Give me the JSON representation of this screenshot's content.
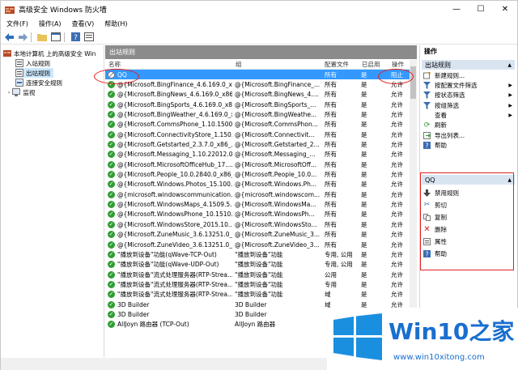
{
  "window": {
    "title": "高级安全 Windows 防火墙"
  },
  "menu": [
    "文件(F)",
    "操作(A)",
    "查看(V)",
    "帮助(H)"
  ],
  "tree": [
    {
      "label": "本地计算机 上的高级安全 Win"
    },
    {
      "label": "入站规则"
    },
    {
      "label": "出站规则"
    },
    {
      "label": "连接安全规则"
    },
    {
      "label": "监视"
    }
  ],
  "middle": {
    "header": "出站规则",
    "columns": [
      "名称",
      "组",
      "配置文件",
      "已启用",
      "操作"
    ]
  },
  "rows": [
    {
      "name": "QQ",
      "group": "",
      "profile": "所有",
      "enabled": "是",
      "action": "阻止",
      "state": "blocked"
    },
    {
      "name": "@{Microsoft.BingFinance_4.6.169.0_x...",
      "group": "@{Microsoft.BingFinance_...",
      "profile": "所有",
      "enabled": "是",
      "action": "允许",
      "state": "allow"
    },
    {
      "name": "@{Microsoft.BingNews_4.6.169.0_x86...",
      "group": "@{Microsoft.BingNews_4....",
      "profile": "所有",
      "enabled": "是",
      "action": "允许",
      "state": "allow"
    },
    {
      "name": "@{Microsoft.BingSports_4.6.169.0_x8...",
      "group": "@{Microsoft.BingSports_...",
      "profile": "所有",
      "enabled": "是",
      "action": "允许",
      "state": "allow"
    },
    {
      "name": "@{Microsoft.BingWeather_4.6.169.0_x...",
      "group": "@{Microsoft.BingWeathe...",
      "profile": "所有",
      "enabled": "是",
      "action": "允许",
      "state": "allow"
    },
    {
      "name": "@{Microsoft.CommsPhone_1.10.1500....",
      "group": "@{Microsoft.CommsPhon...",
      "profile": "所有",
      "enabled": "是",
      "action": "允许",
      "state": "allow"
    },
    {
      "name": "@{Microsoft.ConnectivityStore_1.150....",
      "group": "@{Microsoft.Connectivit...",
      "profile": "所有",
      "enabled": "是",
      "action": "允许",
      "state": "allow"
    },
    {
      "name": "@{Microsoft.Getstarted_2.3.7.0_x86_...",
      "group": "@{Microsoft.Getstarted_2...",
      "profile": "所有",
      "enabled": "是",
      "action": "允许",
      "state": "allow"
    },
    {
      "name": "@{Microsoft.Messaging_1.10.22012.0...",
      "group": "@{Microsoft.Messaging_...",
      "profile": "所有",
      "enabled": "是",
      "action": "允许",
      "state": "allow"
    },
    {
      "name": "@{Microsoft.MicrosoftOfficeHub_17....",
      "group": "@{Microsoft.MicrosoftOff...",
      "profile": "所有",
      "enabled": "是",
      "action": "允许",
      "state": "allow"
    },
    {
      "name": "@{Microsoft.People_10.0.2840.0_x86_...",
      "group": "@{Microsoft.People_10.0...",
      "profile": "所有",
      "enabled": "是",
      "action": "允许",
      "state": "allow"
    },
    {
      "name": "@{Microsoft.Windows.Photos_15.100....",
      "group": "@{Microsoft.Windows.Ph...",
      "profile": "所有",
      "enabled": "是",
      "action": "允许",
      "state": "allow"
    },
    {
      "name": "@{microsoft.windowscommunication...",
      "group": "@{microsoft.windowscom...",
      "profile": "所有",
      "enabled": "是",
      "action": "允许",
      "state": "allow"
    },
    {
      "name": "@{Microsoft.WindowsMaps_4.1509.5...",
      "group": "@{Microsoft.WindowsMa...",
      "profile": "所有",
      "enabled": "是",
      "action": "允许",
      "state": "allow"
    },
    {
      "name": "@{Microsoft.WindowsPhone_10.1510....",
      "group": "@{Microsoft.WindowsPh...",
      "profile": "所有",
      "enabled": "是",
      "action": "允许",
      "state": "allow"
    },
    {
      "name": "@{Microsoft.WindowsStore_2015.10....",
      "group": "@{Microsoft.WindowsSto...",
      "profile": "所有",
      "enabled": "是",
      "action": "允许",
      "state": "allow"
    },
    {
      "name": "@{Microsoft.ZuneMusic_3.6.13251.0_...",
      "group": "@{Microsoft.ZuneMusic_3...",
      "profile": "所有",
      "enabled": "是",
      "action": "允许",
      "state": "allow"
    },
    {
      "name": "@{Microsoft.ZuneVideo_3.6.13251.0_...",
      "group": "@{Microsoft.ZuneVideo_3...",
      "profile": "所有",
      "enabled": "是",
      "action": "允许",
      "state": "allow"
    },
    {
      "name": "\"播放到设备\"功能(qWave-TCP-Out)",
      "group": "\"播放到设备\"功能",
      "profile": "专用, 公用",
      "enabled": "是",
      "action": "允许",
      "state": "allow"
    },
    {
      "name": "\"播放到设备\"功能(qWave-UDP-Out)",
      "group": "\"播放到设备\"功能",
      "profile": "专用, 公用",
      "enabled": "是",
      "action": "允许",
      "state": "allow"
    },
    {
      "name": "\"播放到设备\"流式处理服务器(RTP-Strea...",
      "group": "\"播放到设备\"功能",
      "profile": "公用",
      "enabled": "是",
      "action": "允许",
      "state": "allow"
    },
    {
      "name": "\"播放到设备\"流式处理服务器(RTP-Strea...",
      "group": "\"播放到设备\"功能",
      "profile": "专用",
      "enabled": "是",
      "action": "允许",
      "state": "allow"
    },
    {
      "name": "\"播放到设备\"流式处理服务器(RTP-Strea...",
      "group": "\"播放到设备\"功能",
      "profile": "域",
      "enabled": "是",
      "action": "允许",
      "state": "allow"
    },
    {
      "name": "3D Builder",
      "group": "3D Builder",
      "profile": "域",
      "enabled": "是",
      "action": "允许",
      "state": "allow"
    },
    {
      "name": "3D Builder",
      "group": "3D Builder",
      "profile": "",
      "enabled": "",
      "action": "",
      "state": "allow"
    },
    {
      "name": "AllJoyn 路由器 (TCP-Out)",
      "group": "AllJoyn 路由器",
      "profile": "",
      "enabled": "",
      "action": "",
      "state": "allow"
    }
  ],
  "actions_panel": {
    "title": "操作",
    "section1": {
      "header": "出站规则",
      "items": [
        "新建规则...",
        "按配置文件筛选",
        "按状态筛选",
        "按组筛选",
        "查看",
        "刷新",
        "导出列表...",
        "帮助"
      ]
    },
    "section2": {
      "header": "QQ",
      "items": [
        "禁用规则",
        "剪切",
        "复制",
        "删除",
        "属性",
        "帮助"
      ]
    }
  },
  "watermark": {
    "brand": "Win10之家",
    "site": "www.win10xitong.com"
  },
  "colors": {
    "accent": "#3399ff",
    "allow": "#2e9e33",
    "highlight": "#e02020",
    "brand": "#1a6fcf"
  }
}
